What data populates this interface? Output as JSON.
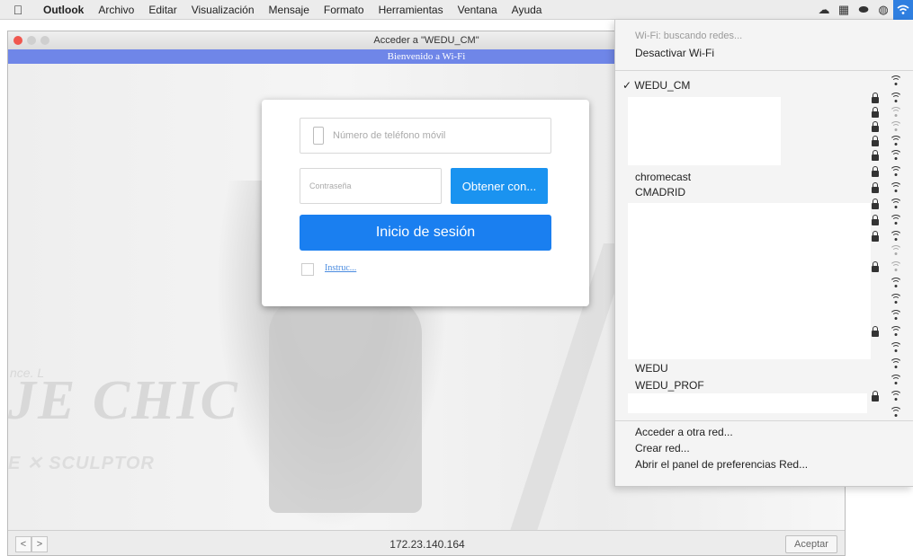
{
  "menubar": {
    "apple": "",
    "items": [
      "Outlook",
      "Archivo",
      "Editar",
      "Visualización",
      "Mensaje",
      "Formato",
      "Herramientas",
      "Ventana",
      "Ayuda"
    ]
  },
  "window": {
    "title": "Acceder a \"WEDU_CM\"",
    "subtitle": "Bienvenido a Wi-Fi"
  },
  "background": {
    "brand_big": "JE CHIC",
    "brand_small": "E ✕ SCULPTOR",
    "tagline": "nce. L"
  },
  "login": {
    "phone_placeholder": "Número de teléfono móvil",
    "password_placeholder": "Contraseña",
    "get_code_button": "Obtener con...",
    "login_button": "Inicio de sesión",
    "checkbox_label": "Instruc..."
  },
  "toolbar": {
    "back": "<",
    "forward": ">",
    "address": "172.23.140.164",
    "accept_button": "Aceptar"
  },
  "wifi_menu": {
    "status": "Wi-Fi: buscando redes...",
    "toggle": "Desactivar Wi-Fi",
    "current_network": "✓ WEDU_CM",
    "networks": [
      "chromecast",
      "CMADRID",
      "WEDU",
      "WEDU_PROF"
    ],
    "actions": [
      "Acceder a otra red...",
      "Crear red...",
      "Abrir el panel de preferencias Red..."
    ]
  },
  "colors": {
    "primary_button": "#1a7ff0",
    "subtitle_bar": "#6f86e8",
    "wifi_active": "#2f7fe0"
  }
}
